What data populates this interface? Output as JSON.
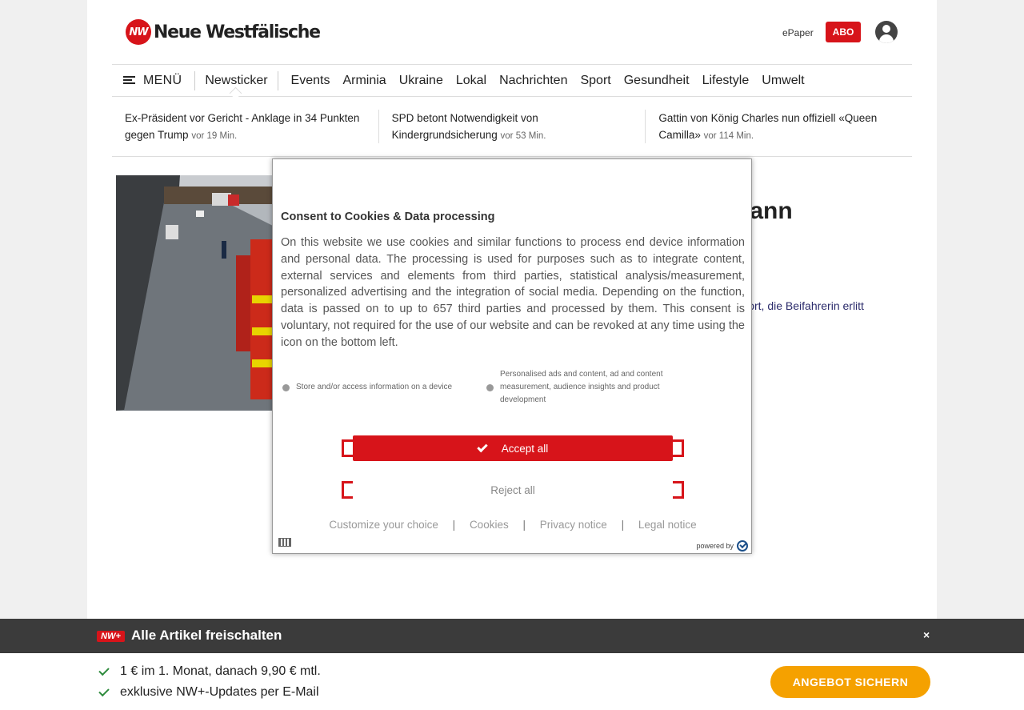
{
  "header": {
    "logo_mark": "NW",
    "logo_text": "Neue Westfälische",
    "epaper_label": "ePaper",
    "abo_label": "ABO"
  },
  "nav": {
    "menu_label": "MENÜ",
    "items": [
      "Newsticker",
      "Events",
      "Arminia",
      "Ukraine",
      "Lokal",
      "Nachrichten",
      "Sport",
      "Gesundheit",
      "Lifestyle",
      "Umwelt"
    ]
  },
  "ticker": [
    {
      "text": "Ex-Präsident vor Gericht - Anklage in 34 Punkten gegen Trump",
      "time": "vor 19 Min."
    },
    {
      "text": "SPD betont Notwendigkeit von Kindergrundsicherung",
      "time": "vor 53 Min."
    },
    {
      "text": "Gattin von König Charles nun offiziell «Queen Camilla»",
      "time": "vor 114 Min."
    }
  ],
  "article": {
    "headline": "n Lkw: Mann\nuf A2 bei",
    "teaser": "llort, die Beifahrerin erlitt"
  },
  "consent": {
    "title": "Consent to Cookies & Data processing",
    "description": "On this website we use cookies and similar functions to process end device information and personal data. The processing is used for purposes such as to integrate content, external services and elements from third parties, statistical analysis/measurement, personalized advertising and the integration of social media. Depending on the function, data is passed on to up to 657 third parties and processed by them. This consent is voluntary, not required for the use of our website and can be revoked at any time using the icon on the bottom left.",
    "purpose_1": "Store and/or access information on a device",
    "purpose_2": "Personalised ads and content, ad and content measurement, audience insights and product development",
    "accept_label": "Accept all",
    "reject_label": "Reject all",
    "link_customize": "Customize your choice",
    "link_cookies": "Cookies",
    "link_privacy": "Privacy notice",
    "link_legal": "Legal notice",
    "separator": "|",
    "powered_by": "powered by"
  },
  "promo": {
    "badge": "NW+",
    "title": "Alle Artikel freischalten",
    "close": "×",
    "benefit_1": "1 € im 1. Monat, danach 9,90 € mtl.",
    "benefit_2": "exklusive NW+-Updates per E-Mail",
    "cta_label": "ANGEBOT SICHERN"
  },
  "colors": {
    "brand_red": "#d7141a",
    "cta_orange": "#f5a100",
    "promo_bar": "#3b3b3b"
  }
}
